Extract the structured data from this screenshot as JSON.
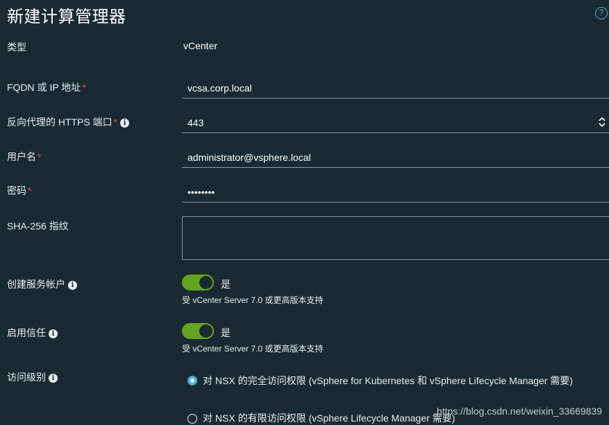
{
  "header": {
    "title": "新建计算管理器",
    "help_icon": "?"
  },
  "form": {
    "type": {
      "label": "类型",
      "value": "vCenter"
    },
    "fqdn": {
      "label": "FQDN 或 IP 地址",
      "required": "*",
      "value": "vcsa.corp.local"
    },
    "port": {
      "label": "反向代理的 HTTPS 端口",
      "required": "*",
      "info": "i",
      "value": "443"
    },
    "username": {
      "label": "用户名",
      "required": "*",
      "value": "administrator@vsphere.local"
    },
    "password": {
      "label": "密码",
      "required": "*",
      "value": "••••••••"
    },
    "thumbprint": {
      "label": "SHA-256 指纹",
      "value": ""
    },
    "service_account": {
      "label": "创建服务帐户",
      "info": "i",
      "toggle_label": "是",
      "hint": "受 vCenter Server 7.0 或更高版本支持"
    },
    "trust": {
      "label": "启用信任",
      "info": "i",
      "toggle_label": "是",
      "hint": "受 vCenter Server 7.0 或更高版本支持"
    },
    "access_level": {
      "label": "访问级别",
      "info": "i",
      "options": [
        {
          "label": "对 NSX 的完全访问权限 (vSphere for Kubernetes 和 vSphere Lifecycle Manager 需要)"
        },
        {
          "label": "对 NSX 的有限访问权限 (vSphere Lifecycle Manager 需要)"
        }
      ]
    }
  },
  "watermark": "https://blog.csdn.net/weixin_33669839",
  "colors": {
    "background": "#1b2a32",
    "accent": "#49afd9",
    "toggle_on": "#62a420",
    "required": "#ef4848"
  }
}
